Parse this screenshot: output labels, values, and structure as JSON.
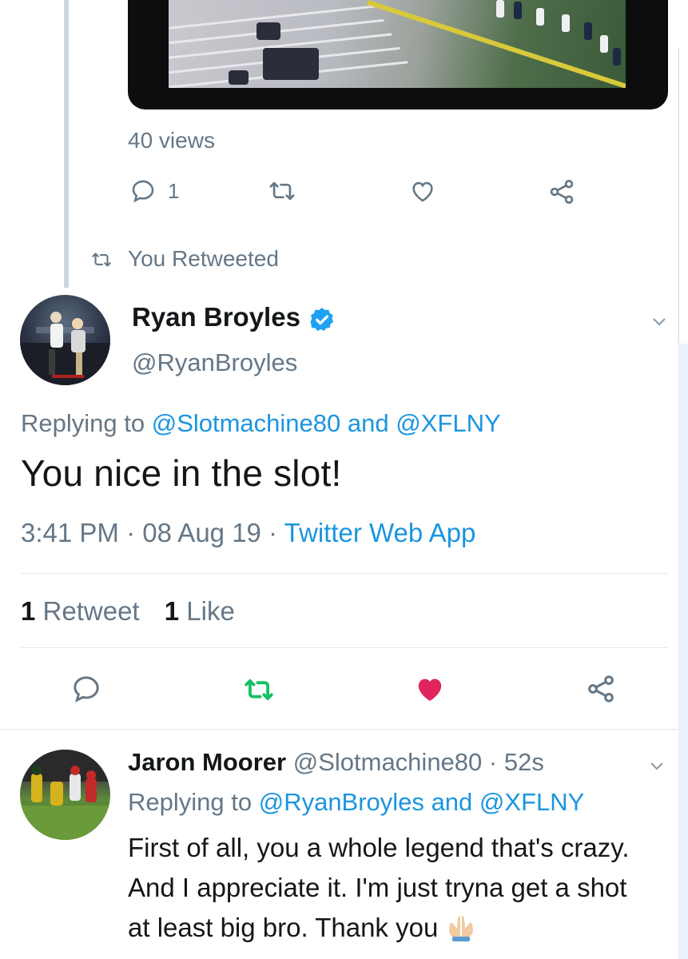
{
  "previous_tweet": {
    "views": "40 views",
    "reply_count": "1"
  },
  "retweet_context": {
    "label": "You Retweeted"
  },
  "main_tweet": {
    "author_name": "Ryan Broyles",
    "author_handle": "@RyanBroyles",
    "replying_prefix": "Replying to",
    "replying_user1": "@Slotmachine80",
    "replying_and": "and",
    "replying_user2": "@XFLNY",
    "text": "You nice in the slot!",
    "time": "3:41 PM",
    "date": "08 Aug 19",
    "source": "Twitter Web App",
    "dot": "·",
    "retweets_count": "1",
    "retweets_label": "Retweet",
    "likes_count": "1",
    "likes_label": "Like",
    "retweeted_color": "#17bf63",
    "liked_color": "#e0245e"
  },
  "reply": {
    "author_name": "Jaron Moorer",
    "author_handle": "@Slotmachine80",
    "dot": "·",
    "age": "52s",
    "replying_prefix": "Replying to",
    "replying_user1": "@RyanBroyles",
    "replying_and": "and",
    "replying_user2": "@XFLNY",
    "text": "First of all, you a whole legend that's crazy. And I appreciate it. I'm just tryna get a shot at least big bro. Thank you",
    "emoji": "folded-hands"
  },
  "colors": {
    "link": "#1b95e0",
    "muted": "#657786"
  }
}
